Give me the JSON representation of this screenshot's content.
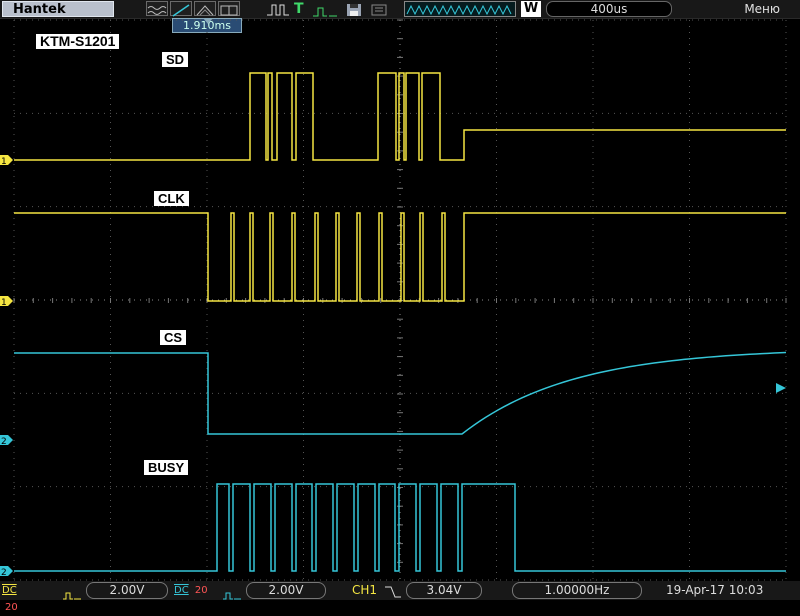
{
  "header": {
    "brand": "Hantek",
    "trigger_mode": "T",
    "acquisition_mode": "W",
    "timebase": "400us",
    "menu_label": "Меню",
    "trigger_position": "1.910ms"
  },
  "screen_title": "KTM-S1201",
  "channels": [
    {
      "label": "SD",
      "marker": "1",
      "color": "#f5e642"
    },
    {
      "label": "CLK",
      "marker": "1",
      "color": "#f5e642"
    },
    {
      "label": "CS",
      "marker": "2",
      "color": "#35c6d8"
    },
    {
      "label": "BUSY",
      "marker": "2",
      "color": "#35c6d8"
    }
  ],
  "footer": {
    "ch1_coupling": "DC",
    "ch1_bw": "20",
    "ch1_volts": "2.00V",
    "ch2_coupling": "DC",
    "ch2_bw": "20",
    "ch2_volts": "2.00V",
    "trigger_source": "CH1",
    "trigger_level": "3.04V",
    "frequency": "1.00000Hz",
    "datetime": "19-Apr-17 10:03"
  }
}
